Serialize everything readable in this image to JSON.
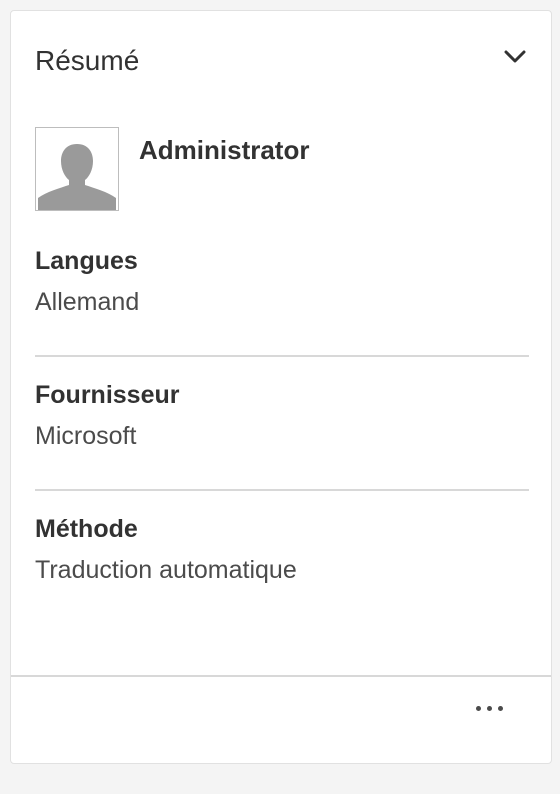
{
  "card": {
    "title": "Résumé",
    "collapse_icon": "chevron-down-icon",
    "user": {
      "name": "Administrator",
      "avatar_icon": "user-silhouette-icon"
    },
    "fields": [
      {
        "label": "Langues",
        "value": "Allemand"
      },
      {
        "label": "Fournisseur",
        "value": "Microsoft"
      },
      {
        "label": "Méthode",
        "value": "Traduction automatique"
      }
    ],
    "more_icon": "more-options-icon"
  },
  "colors": {
    "background": "#f4f4f4",
    "card": "#ffffff",
    "text": "#323232",
    "divider": "#d8d8d8",
    "avatar_silhouette": "#9a9a9a"
  }
}
